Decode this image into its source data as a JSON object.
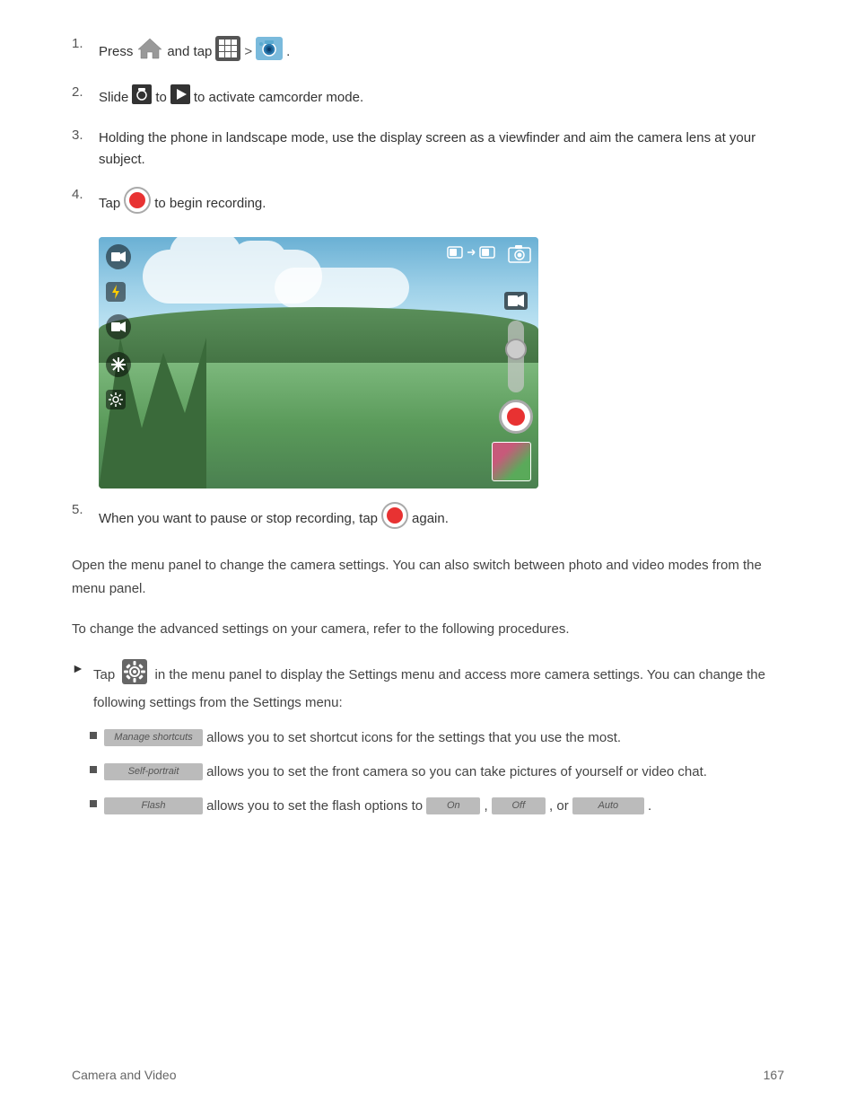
{
  "steps": [
    {
      "num": "1.",
      "parts": [
        "Press",
        "and_tap_icon",
        "and tap",
        "grid_icon",
        ">",
        "camera_icon"
      ]
    },
    {
      "num": "2.",
      "text": "to activate camcorder mode.",
      "has_slide": true
    },
    {
      "num": "3.",
      "text": "Holding the phone in landscape mode, use the display screen as a viewfinder and aim the camera lens at your subject."
    },
    {
      "num": "4.",
      "text": "to begin recording.",
      "has_record": true
    }
  ],
  "step5": {
    "num": "5.",
    "text_before": "When you want to pause or stop recording, tap",
    "text_after": "again."
  },
  "paragraph1": "Open the menu panel to change the camera settings. You can also switch between photo and video modes from the menu panel.",
  "paragraph2": "To change the advanced settings on your camera, refer to the following procedures.",
  "arrow_item": {
    "prefix": "Tap",
    "middle": "in the menu panel to display the Settings menu and access more camera settings. You can change the following settings from the Settings menu:"
  },
  "bullets": [
    {
      "placeholder": "Manage shortcuts",
      "text": "allows you to set shortcut icons for the settings that you use the most."
    },
    {
      "placeholder": "Self-portrait",
      "text": "allows you to set the front camera so you can take pictures of yourself or video chat."
    },
    {
      "placeholder": "Flash",
      "text": "allows you to set the flash options to"
    }
  ],
  "flash_options": [
    ", ",
    ", or",
    "."
  ],
  "footer": {
    "left": "Camera and Video",
    "right": "167"
  }
}
